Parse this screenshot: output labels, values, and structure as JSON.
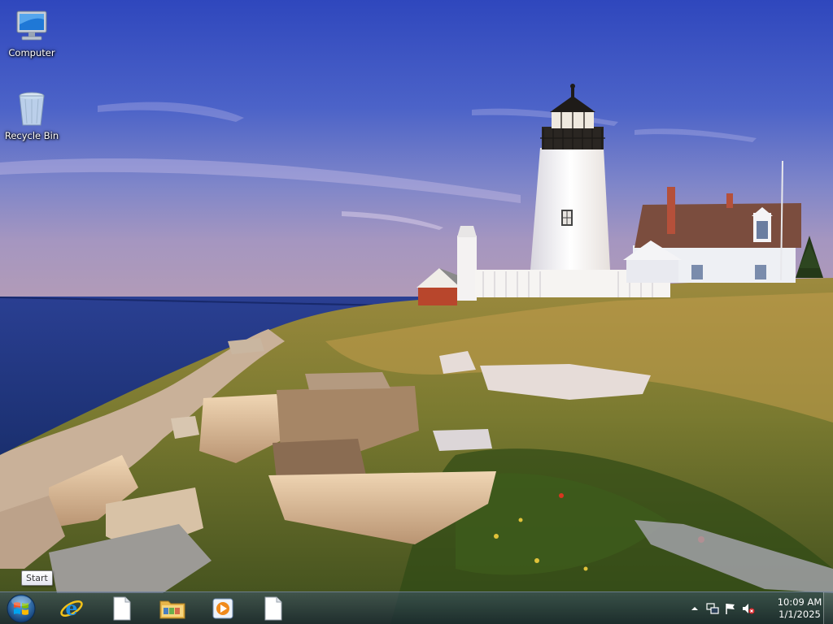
{
  "desktop": {
    "icons": [
      {
        "label": "Computer",
        "icon": "computer-icon"
      },
      {
        "label": "Recycle Bin",
        "icon": "recycle-bin-icon"
      }
    ]
  },
  "tooltip": {
    "text": "Start"
  },
  "taskbar": {
    "start_icon": "windows-orb-icon",
    "pinned": [
      {
        "icon": "internet-explorer-icon"
      },
      {
        "icon": "blank-document-icon"
      },
      {
        "icon": "file-explorer-icon"
      },
      {
        "icon": "media-player-icon"
      },
      {
        "icon": "blank-document-icon"
      }
    ]
  },
  "tray": {
    "icons": [
      "show-hidden-icons-chevron",
      "network-icon",
      "action-center-flag-icon",
      "volume-muted-icon"
    ],
    "time": "10:09 AM",
    "date": "1/1/2025"
  },
  "colors": {
    "sky": "#3a52c4",
    "sea": "#1f3d86",
    "taskbar": "#2a3f58"
  }
}
